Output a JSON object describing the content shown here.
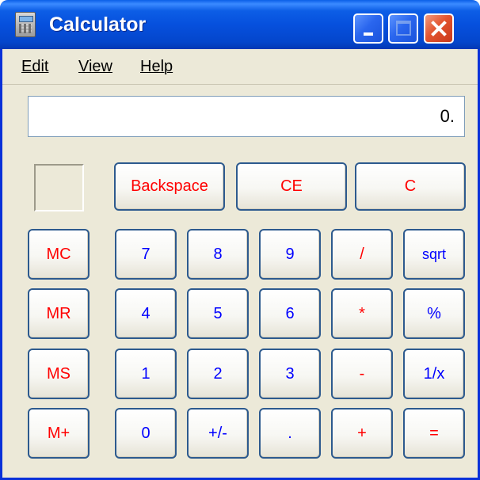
{
  "window": {
    "title": "Calculator"
  },
  "menu": {
    "edit": "Edit",
    "view": "View",
    "help": "Help"
  },
  "display": {
    "value": "0."
  },
  "keys": {
    "backspace": "Backspace",
    "ce": "CE",
    "c": "C",
    "mc": "MC",
    "mr": "MR",
    "ms": "MS",
    "mplus": "M+",
    "n7": "7",
    "n8": "8",
    "n9": "9",
    "div": "/",
    "sqrt": "sqrt",
    "n4": "4",
    "n5": "5",
    "n6": "6",
    "mul": "*",
    "pct": "%",
    "n1": "1",
    "n2": "2",
    "n3": "3",
    "sub": "-",
    "recip": "1/x",
    "n0": "0",
    "sign": "+/-",
    "dot": ".",
    "add": "+",
    "eq": "="
  },
  "colors": {
    "operator": "#ff0000",
    "digit": "#0000ff",
    "titlebar": "#0650dd",
    "window_bg": "#ece9d8"
  }
}
